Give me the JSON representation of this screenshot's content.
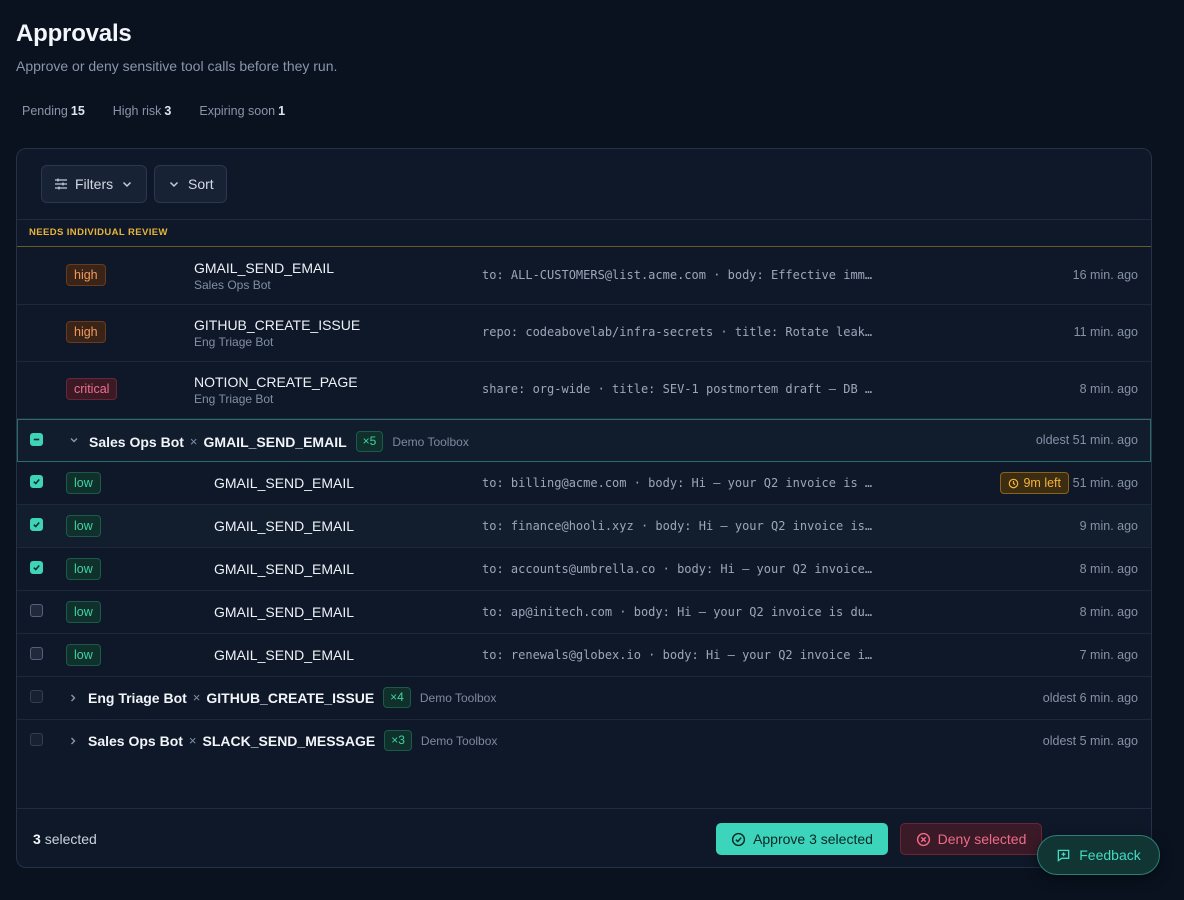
{
  "header": {
    "title": "Approvals",
    "subtitle": "Approve or deny sensitive tool calls before they run."
  },
  "stats": [
    {
      "label": "Pending",
      "value": "15"
    },
    {
      "label": "High risk",
      "value": "3"
    },
    {
      "label": "Expiring soon",
      "value": "1"
    }
  ],
  "toolbar": {
    "filters_label": "Filters",
    "sort_label": "Sort"
  },
  "section": {
    "title": "NEEDS INDIVIDUAL REVIEW"
  },
  "review_rows": [
    {
      "risk": "high",
      "tool": "GMAIL_SEND_EMAIL",
      "agent": "Sales Ops Bot",
      "args": "to: ALL-CUSTOMERS@list.acme.com · body: Effective imm…",
      "time": "16 min. ago"
    },
    {
      "risk": "high",
      "tool": "GITHUB_CREATE_ISSUE",
      "agent": "Eng Triage Bot",
      "args": "repo: codeabovelab/infra-secrets · title: Rotate leak…",
      "time": "11 min. ago"
    },
    {
      "risk": "critical",
      "tool": "NOTION_CREATE_PAGE",
      "agent": "Eng Triage Bot",
      "args": "share: org-wide · title: SEV-1 postmortem draft — DB …",
      "time": "8 min. ago"
    }
  ],
  "groups": [
    {
      "agent": "Sales Ops Bot",
      "sep": "×",
      "tool": "GMAIL_SEND_EMAIL",
      "count": "×5",
      "toolbox": "Demo Toolbox",
      "oldest": "oldest 51 min. ago"
    },
    {
      "agent": "Eng Triage Bot",
      "sep": "×",
      "tool": "GITHUB_CREATE_ISSUE",
      "count": "×4",
      "toolbox": "Demo Toolbox",
      "oldest": "oldest 6 min. ago"
    },
    {
      "agent": "Sales Ops Bot",
      "sep": "×",
      "tool": "SLACK_SEND_MESSAGE",
      "count": "×3",
      "toolbox": "Demo Toolbox",
      "oldest": "oldest 5 min. ago"
    }
  ],
  "group_items": [
    {
      "risk": "low",
      "tool": "GMAIL_SEND_EMAIL",
      "args": "to: billing@acme.com · body: Hi — your Q2 invoice is …",
      "expiry": "9m left",
      "time": "51 min. ago",
      "checked": true
    },
    {
      "risk": "low",
      "tool": "GMAIL_SEND_EMAIL",
      "args": "to: finance@hooli.xyz · body: Hi — your Q2 invoice is…",
      "time": "9 min. ago",
      "checked": true
    },
    {
      "risk": "low",
      "tool": "GMAIL_SEND_EMAIL",
      "args": "to: accounts@umbrella.co · body: Hi — your Q2 invoice…",
      "time": "8 min. ago",
      "checked": true
    },
    {
      "risk": "low",
      "tool": "GMAIL_SEND_EMAIL",
      "args": "to: ap@initech.com · body: Hi — your Q2 invoice is du…",
      "time": "8 min. ago",
      "checked": false
    },
    {
      "risk": "low",
      "tool": "GMAIL_SEND_EMAIL",
      "args": "to: renewals@globex.io · body: Hi — your Q2 invoice i…",
      "time": "7 min. ago",
      "checked": false
    }
  ],
  "footer": {
    "selected_count": "3",
    "selected_label": "selected",
    "approve_label": "Approve 3 selected",
    "deny_label": "Deny selected"
  },
  "feedback": {
    "label": "Feedback"
  },
  "colors": {
    "accent": "#3dd4bc",
    "high": "#f2995a",
    "critical": "#f07090",
    "low": "#3fd3a4",
    "warning": "#e8b53a"
  }
}
